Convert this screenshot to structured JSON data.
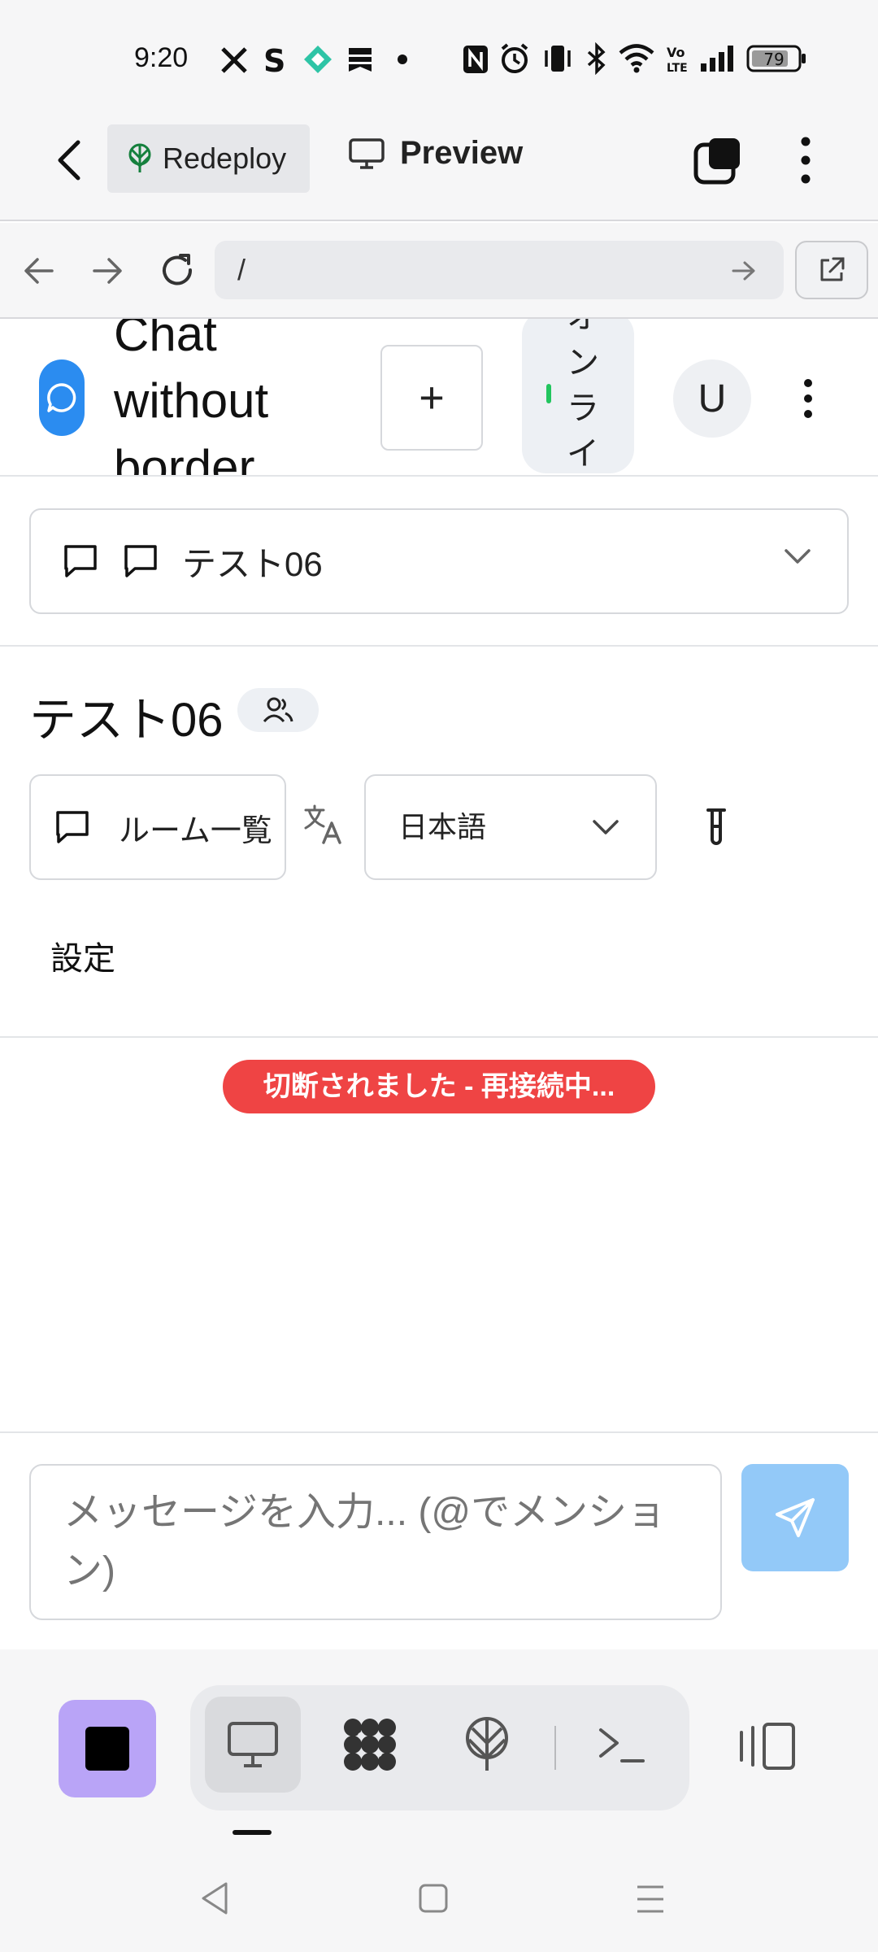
{
  "status_bar": {
    "time": "9:20",
    "battery": "79"
  },
  "app_header": {
    "redeploy_label": "Redeploy",
    "preview_label": "Preview"
  },
  "browser": {
    "url": "/"
  },
  "page_header": {
    "title": "Chat without border",
    "status_label": "オンライン",
    "avatar_initial": "U"
  },
  "room_select": {
    "selected": "テスト06"
  },
  "room": {
    "title": "テスト06",
    "room_list_label": "ルーム一覧",
    "language_selected": "日本語",
    "settings_label": "設定"
  },
  "connection": {
    "message": "切断されました - 再接続中..."
  },
  "composer": {
    "placeholder": "メッセージを入力... (@でメンション)"
  },
  "colors": {
    "accent": "#2b8cf0",
    "error": "#ef4444",
    "online": "#22c55e",
    "send_button": "#93c9f8",
    "stop_button": "#b9a4f7"
  },
  "icons": [
    "back-icon",
    "redeploy-icon",
    "monitor-icon",
    "tabs-icon",
    "more-vertical-icon",
    "arrow-left-icon",
    "arrow-right-icon",
    "reload-icon",
    "go-icon",
    "external-link-icon",
    "chat-logo-icon",
    "plus-icon",
    "chat-icon",
    "chevron-down-icon",
    "users-icon",
    "translate-icon",
    "flask-icon",
    "send-icon",
    "stop-icon",
    "desktop-icon",
    "apps-icon",
    "antenna-icon",
    "terminal-icon",
    "split-view-icon"
  ]
}
